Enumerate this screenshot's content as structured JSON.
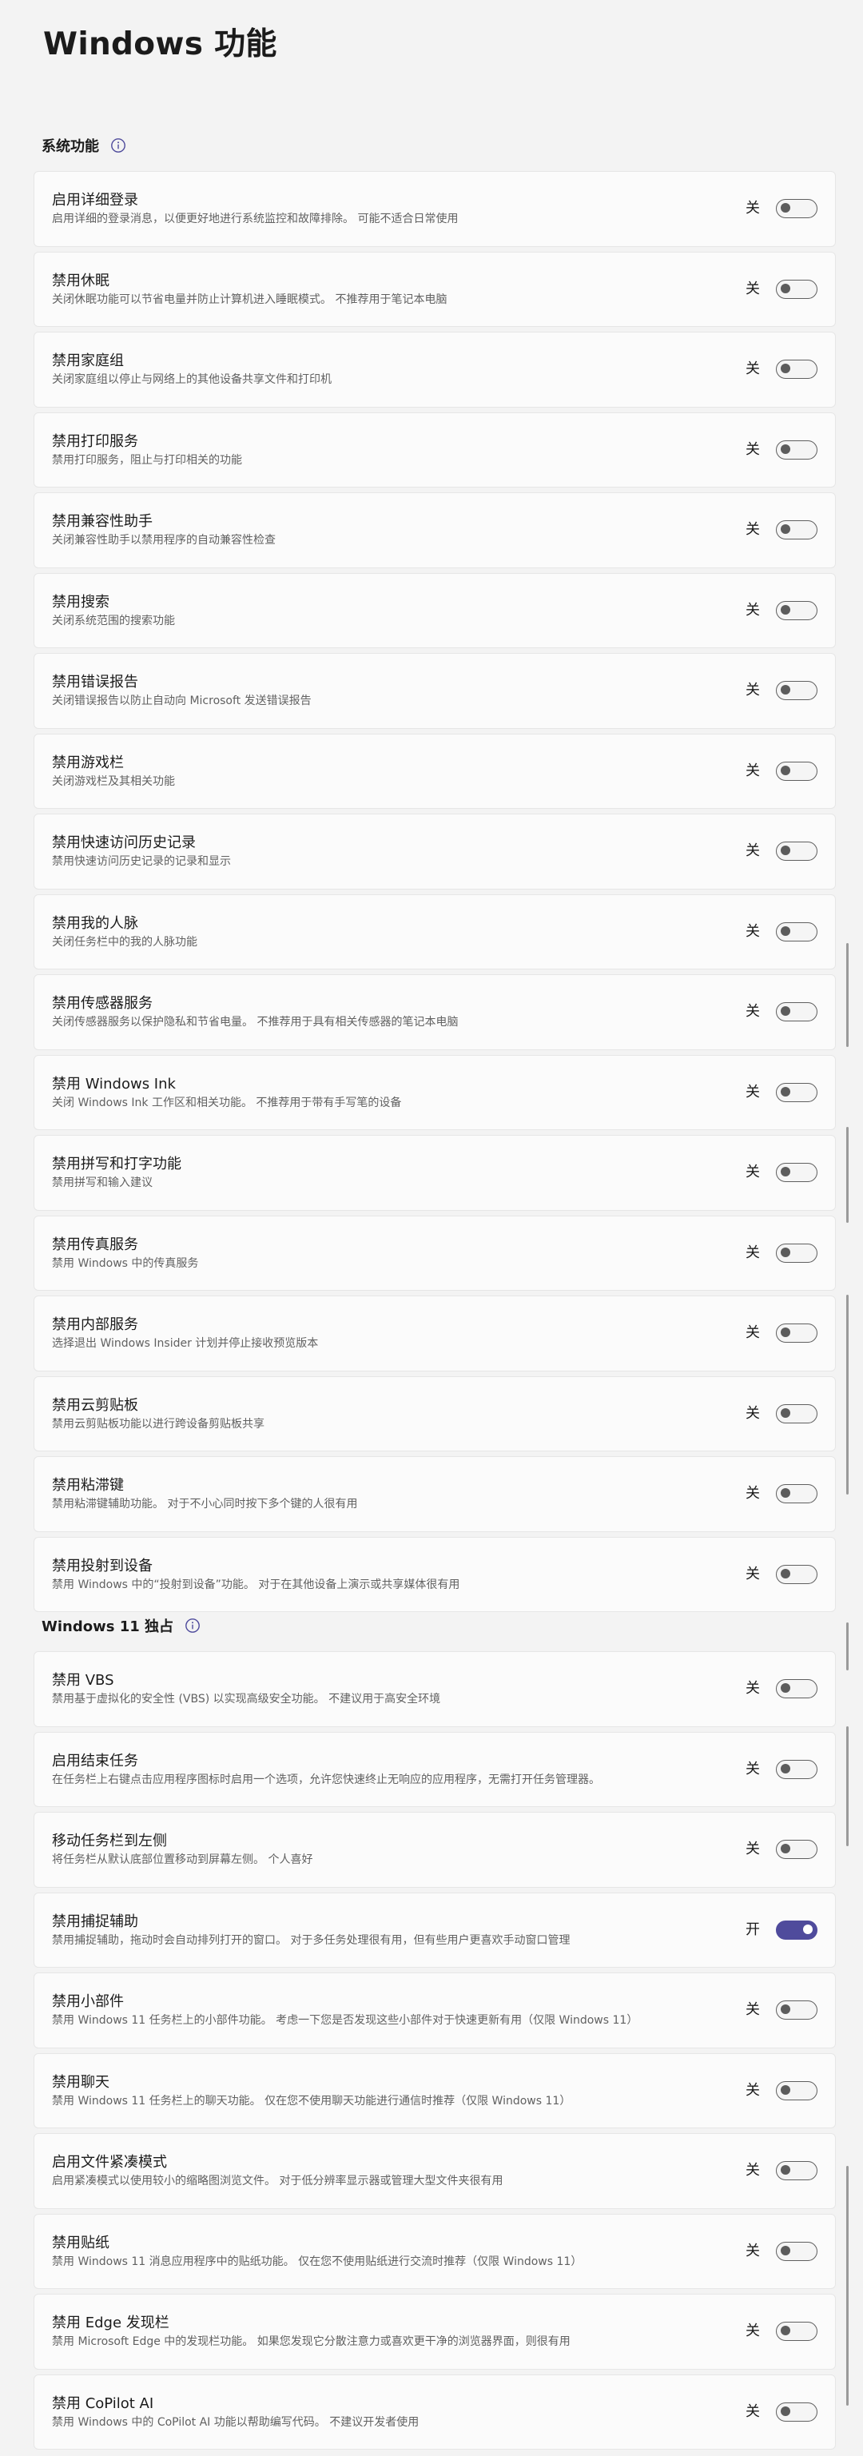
{
  "page": {
    "title": "Windows 功能"
  },
  "sections": [
    {
      "title": "系统功能",
      "info_icon": "info-icon",
      "items": [
        {
          "title": "启用详细登录",
          "desc": "启用详细的登录消息，以便更好地进行系统监控和故障排除。 可能不适合日常使用",
          "state": "关",
          "on": false
        },
        {
          "title": "禁用休眠",
          "desc": "关闭休眠功能可以节省电量并防止计算机进入睡眠模式。 不推荐用于笔记本电脑",
          "state": "关",
          "on": false
        },
        {
          "title": "禁用家庭组",
          "desc": "关闭家庭组以停止与网络上的其他设备共享文件和打印机",
          "state": "关",
          "on": false
        },
        {
          "title": "禁用打印服务",
          "desc": "禁用打印服务，阻止与打印相关的功能",
          "state": "关",
          "on": false
        },
        {
          "title": "禁用兼容性助手",
          "desc": "关闭兼容性助手以禁用程序的自动兼容性检查",
          "state": "关",
          "on": false
        },
        {
          "title": "禁用搜索",
          "desc": "关闭系统范围的搜索功能",
          "state": "关",
          "on": false
        },
        {
          "title": "禁用错误报告",
          "desc": "关闭错误报告以防止自动向 Microsoft 发送错误报告",
          "state": "关",
          "on": false
        },
        {
          "title": "禁用游戏栏",
          "desc": "关闭游戏栏及其相关功能",
          "state": "关",
          "on": false
        },
        {
          "title": "禁用快速访问历史记录",
          "desc": "禁用快速访问历史记录的记录和显示",
          "state": "关",
          "on": false
        },
        {
          "title": "禁用我的人脉",
          "desc": "关闭任务栏中的我的人脉功能",
          "state": "关",
          "on": false
        },
        {
          "title": "禁用传感器服务",
          "desc": "关闭传感器服务以保护隐私和节省电量。 不推荐用于具有相关传感器的笔记本电脑",
          "state": "关",
          "on": false
        },
        {
          "title": "禁用 Windows Ink",
          "desc": "关闭 Windows Ink 工作区和相关功能。 不推荐用于带有手写笔的设备",
          "state": "关",
          "on": false
        },
        {
          "title": "禁用拼写和打字功能",
          "desc": "禁用拼写和输入建议",
          "state": "关",
          "on": false
        },
        {
          "title": "禁用传真服务",
          "desc": "禁用 Windows 中的传真服务",
          "state": "关",
          "on": false
        },
        {
          "title": "禁用内部服务",
          "desc": "选择退出 Windows Insider 计划并停止接收预览版本",
          "state": "关",
          "on": false
        },
        {
          "title": "禁用云剪贴板",
          "desc": "禁用云剪贴板功能以进行跨设备剪贴板共享",
          "state": "关",
          "on": false
        },
        {
          "title": "禁用粘滞键",
          "desc": "禁用粘滞键辅助功能。 对于不小心同时按下多个键的人很有用",
          "state": "关",
          "on": false
        },
        {
          "title": "禁用投射到设备",
          "desc": "禁用 Windows 中的“投射到设备”功能。 对于在其他设备上演示或共享媒体很有用",
          "state": "关",
          "on": false
        }
      ]
    },
    {
      "title": "Windows 11 独占",
      "info_icon": "info-icon",
      "items": [
        {
          "title": "禁用 VBS",
          "desc": "禁用基于虚拟化的安全性 (VBS) 以实现高级安全功能。 不建议用于高安全环境",
          "state": "关",
          "on": false
        },
        {
          "title": "启用结束任务",
          "desc": "在任务栏上右键点击应用程序图标时启用一个选项，允许您快速终止无响应的应用程序，无需打开任务管理器。",
          "state": "关",
          "on": false
        },
        {
          "title": "移动任务栏到左侧",
          "desc": "将任务栏从默认底部位置移动到屏幕左侧。 个人喜好",
          "state": "关",
          "on": false
        },
        {
          "title": "禁用捕捉辅助",
          "desc": "禁用捕捉辅助，拖动时会自动排列打开的窗口。 对于多任务处理很有用，但有些用户更喜欢手动窗口管理",
          "state": "开",
          "on": true
        },
        {
          "title": "禁用小部件",
          "desc": "禁用 Windows 11 任务栏上的小部件功能。 考虑一下您是否发现这些小部件对于快速更新有用（仅限 Windows 11）",
          "state": "关",
          "on": false
        },
        {
          "title": "禁用聊天",
          "desc": "禁用 Windows 11 任务栏上的聊天功能。 仅在您不使用聊天功能进行通信时推荐（仅限 Windows 11）",
          "state": "关",
          "on": false
        },
        {
          "title": "启用文件紧凑模式",
          "desc": "启用紧凑模式以使用较小的缩略图浏览文件。 对于低分辨率显示器或管理大型文件夹很有用",
          "state": "关",
          "on": false
        },
        {
          "title": "禁用贴纸",
          "desc": "禁用 Windows 11 消息应用程序中的贴纸功能。 仅在您不使用贴纸进行交流时推荐（仅限 Windows 11）",
          "state": "关",
          "on": false
        },
        {
          "title": "禁用 Edge 发现栏",
          "desc": "禁用 Microsoft Edge 中的发现栏功能。 如果您发现它分散注意力或喜欢更干净的浏览器界面，则很有用",
          "state": "关",
          "on": false
        },
        {
          "title": "禁用 CoPilot AI",
          "desc": "禁用 Windows 中的 CoPilot AI 功能以帮助编写代码。 不建议开发者使用",
          "state": "关",
          "on": false
        }
      ]
    }
  ],
  "colors": {
    "background": "#f3f3f3",
    "card": "#fbfbfb",
    "accent_toggle_on": "#4f4b9c",
    "secondary_text": "#616161"
  }
}
